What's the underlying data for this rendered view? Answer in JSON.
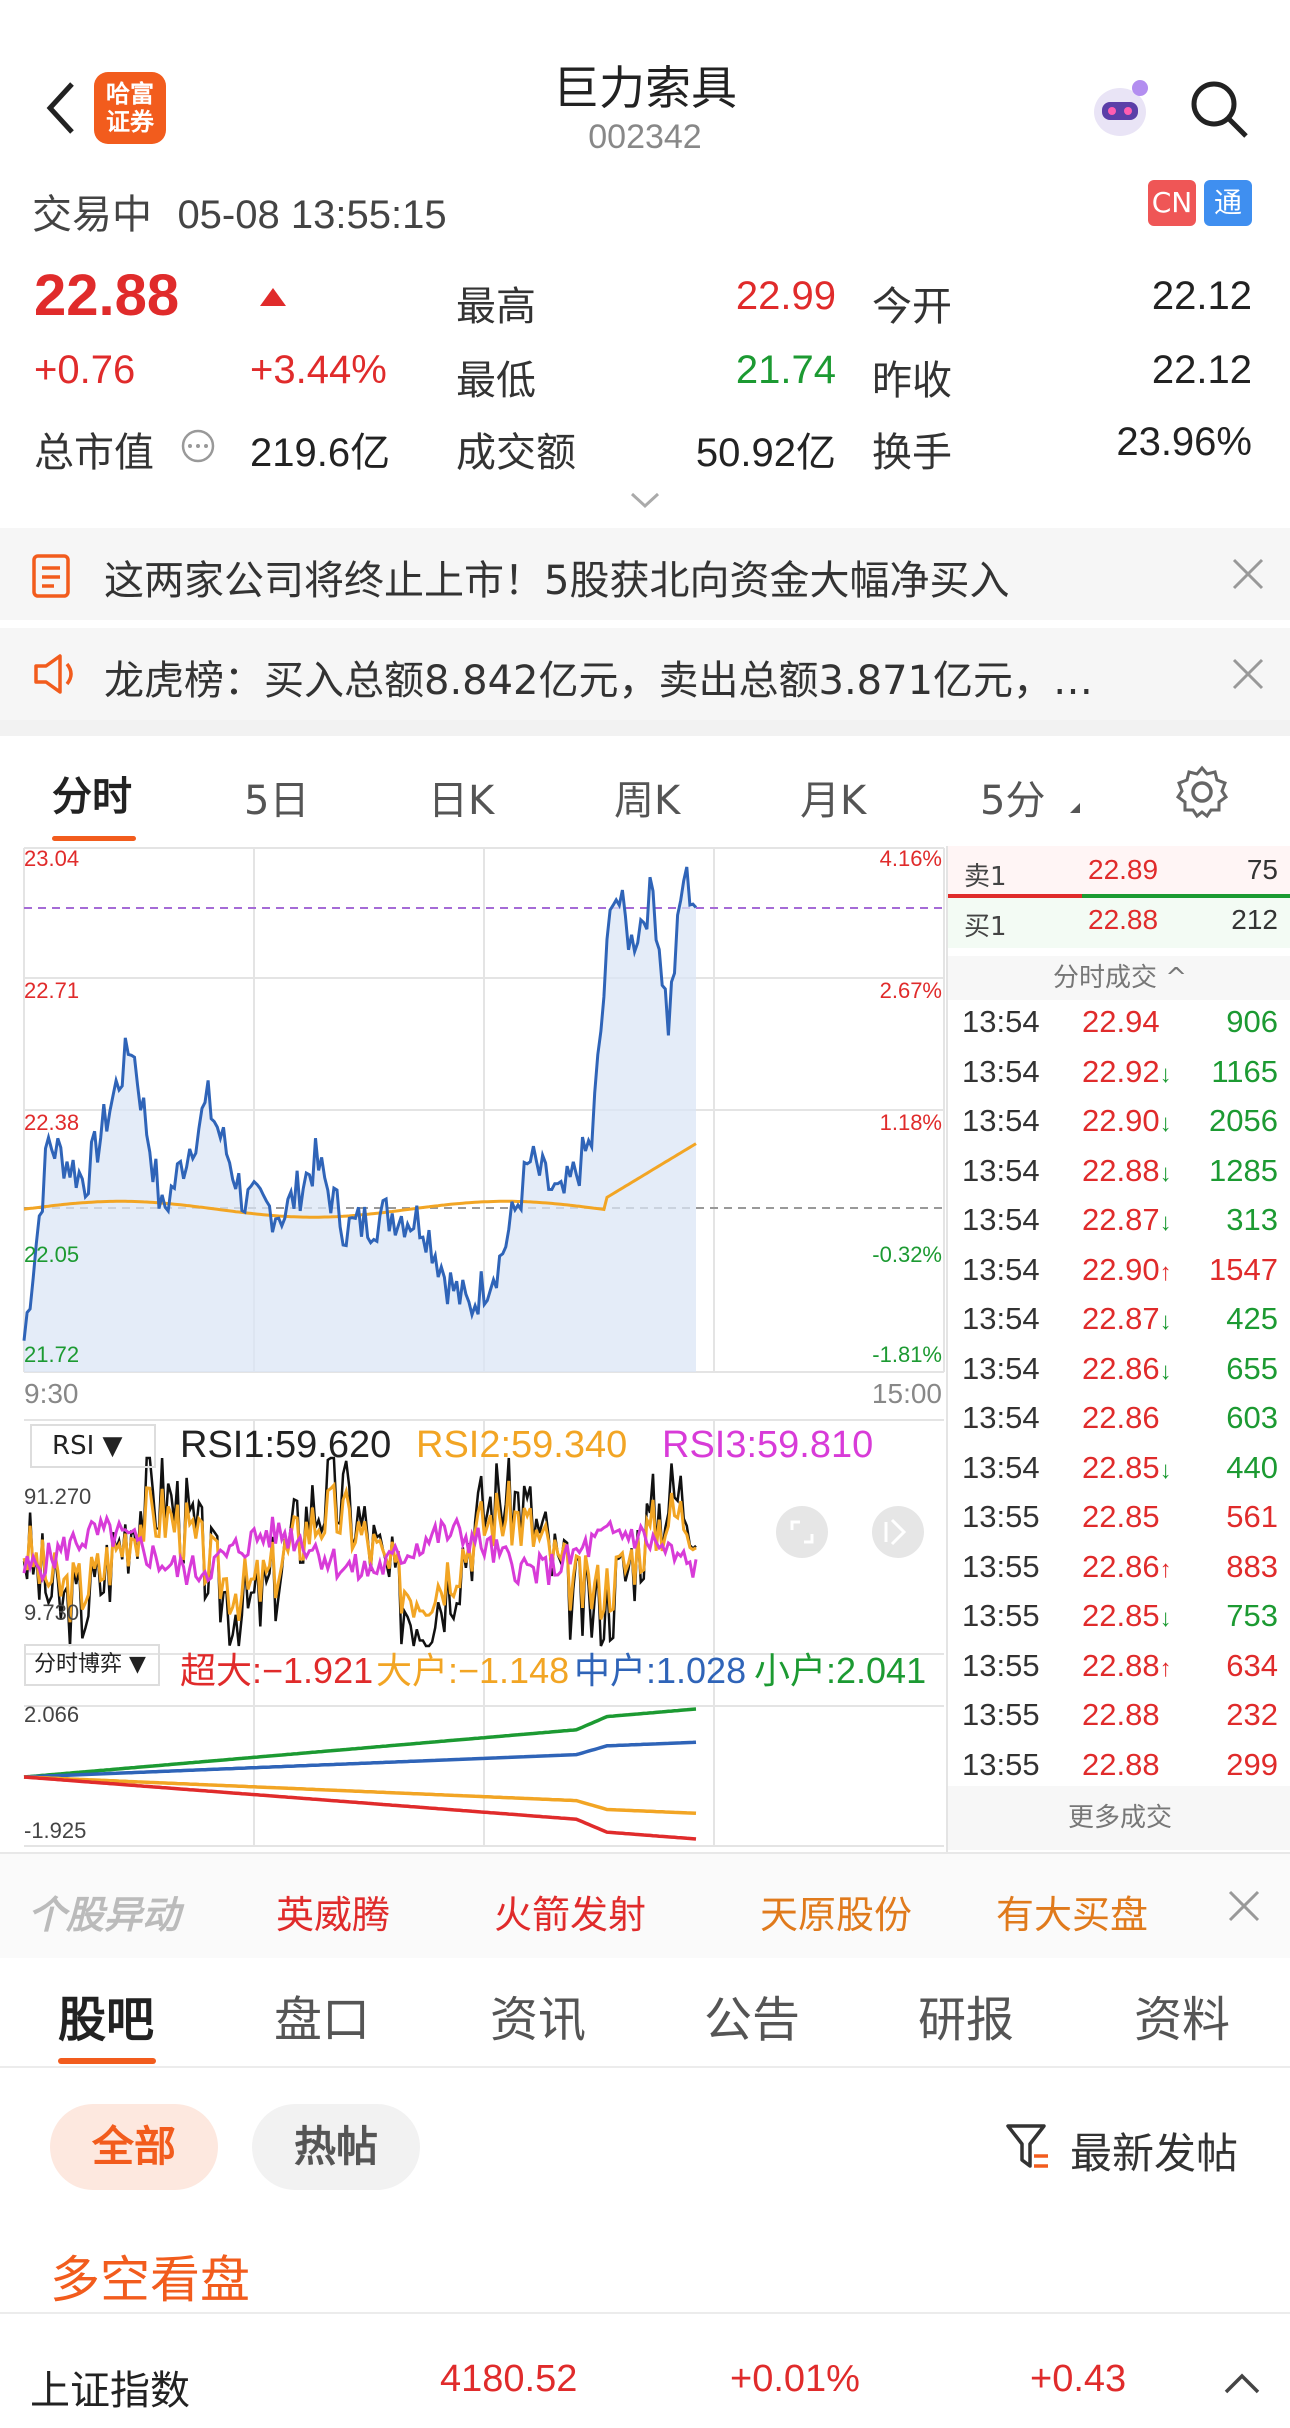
{
  "header": {
    "title": "巨力索具",
    "code": "002342",
    "logo_text": [
      "哈富",
      "证券"
    ],
    "back_icon": "chevron-left-icon",
    "search_icon": "search-icon",
    "avatar_icon": "robot-avatar-icon"
  },
  "status": {
    "state": "交易中",
    "datetime": "05-08 13:55:15",
    "badge_cn": "CN",
    "badge_tong": "通"
  },
  "quote": {
    "price": "22.88",
    "change": "+0.76",
    "change_pct": "+3.44%",
    "mcap_label": "总市值",
    "mcap": "219.6亿",
    "high_label": "最高",
    "high": "22.99",
    "low_label": "最低",
    "low": "21.74",
    "amount_label": "成交额",
    "amount": "50.92亿",
    "open_label": "今开",
    "open": "22.12",
    "prev_label": "昨收",
    "prev": "22.12",
    "turnover_label": "换手",
    "turnover": "23.96%"
  },
  "news": [
    {
      "text": "这两家公司将终止上市！5股获北向资金大幅净买入",
      "icon": "document-icon"
    },
    {
      "text": "龙虎榜：买入总额8.842亿元，卖出总额3.871亿元，…",
      "icon": "speaker-icon"
    }
  ],
  "chart_tabs": [
    "分时",
    "5日",
    "日K",
    "周K",
    "月K",
    "5分"
  ],
  "chart": {
    "y_left": [
      "23.04",
      "22.71",
      "22.38",
      "22.05",
      "21.72"
    ],
    "y_right": [
      "4.16%",
      "2.67%",
      "1.18%",
      "-0.32%",
      "-1.81%"
    ],
    "x_start": "9:30",
    "x_end": "15:00"
  },
  "rsi": {
    "selector": "RSI",
    "rsi1": "RSI1:59.620",
    "rsi2": "RSI2:59.340",
    "rsi3": "RSI3:59.810",
    "max": "91.270",
    "min": "9.730"
  },
  "flow": {
    "selector": "分时博弈",
    "super": "超大:−1.921",
    "large": "大户:−1.148",
    "mid": "中户:1.028",
    "small": "小户:2.041",
    "max": "2.066",
    "min": "-1.925"
  },
  "orderbook": {
    "sell_label": "卖1",
    "sell_price": "22.89",
    "sell_vol": "75",
    "buy_label": "买1",
    "buy_price": "22.88",
    "buy_vol": "212",
    "trades_header": "分时成交 ^",
    "more": "更多成交"
  },
  "trades": [
    {
      "t": "13:54",
      "p": "22.94",
      "a": "",
      "v": "906",
      "vc": "g"
    },
    {
      "t": "13:54",
      "p": "22.92",
      "a": "↓",
      "v": "1165",
      "vc": "g"
    },
    {
      "t": "13:54",
      "p": "22.90",
      "a": "↓",
      "v": "2056",
      "vc": "g"
    },
    {
      "t": "13:54",
      "p": "22.88",
      "a": "↓",
      "v": "1285",
      "vc": "g"
    },
    {
      "t": "13:54",
      "p": "22.87",
      "a": "↓",
      "v": "313",
      "vc": "g"
    },
    {
      "t": "13:54",
      "p": "22.90",
      "a": "↑",
      "v": "1547",
      "vc": "r"
    },
    {
      "t": "13:54",
      "p": "22.87",
      "a": "↓",
      "v": "425",
      "vc": "g"
    },
    {
      "t": "13:54",
      "p": "22.86",
      "a": "↓",
      "v": "655",
      "vc": "g"
    },
    {
      "t": "13:54",
      "p": "22.86",
      "a": "",
      "v": "603",
      "vc": "g"
    },
    {
      "t": "13:54",
      "p": "22.85",
      "a": "↓",
      "v": "440",
      "vc": "g"
    },
    {
      "t": "13:55",
      "p": "22.85",
      "a": "",
      "v": "561",
      "vc": "r"
    },
    {
      "t": "13:55",
      "p": "22.86",
      "a": "↑",
      "v": "883",
      "vc": "r"
    },
    {
      "t": "13:55",
      "p": "22.85",
      "a": "↓",
      "v": "753",
      "vc": "g"
    },
    {
      "t": "13:55",
      "p": "22.88",
      "a": "↑",
      "v": "634",
      "vc": "r"
    },
    {
      "t": "13:55",
      "p": "22.88",
      "a": "",
      "v": "232",
      "vc": "r"
    },
    {
      "t": "13:55",
      "p": "22.88",
      "a": "",
      "v": "299",
      "vc": "r"
    }
  ],
  "hot": {
    "label": "个股异动",
    "items": [
      "英威腾",
      "火箭发射",
      "天原股份",
      "有大买盘"
    ]
  },
  "tabs2": [
    "股吧",
    "盘口",
    "资讯",
    "公告",
    "研报",
    "资料"
  ],
  "filters": {
    "all": "全部",
    "hot": "热帖",
    "newest": "最新发帖"
  },
  "section": "多空看盘",
  "index": {
    "name": "上证指数",
    "value": "4180.52",
    "pct": "+0.01%",
    "chg": "+0.43"
  },
  "colors": {
    "red": "#e02b2b",
    "green": "#1c9a32",
    "orange": "#f25c1d",
    "blue": "#2f64b8"
  }
}
